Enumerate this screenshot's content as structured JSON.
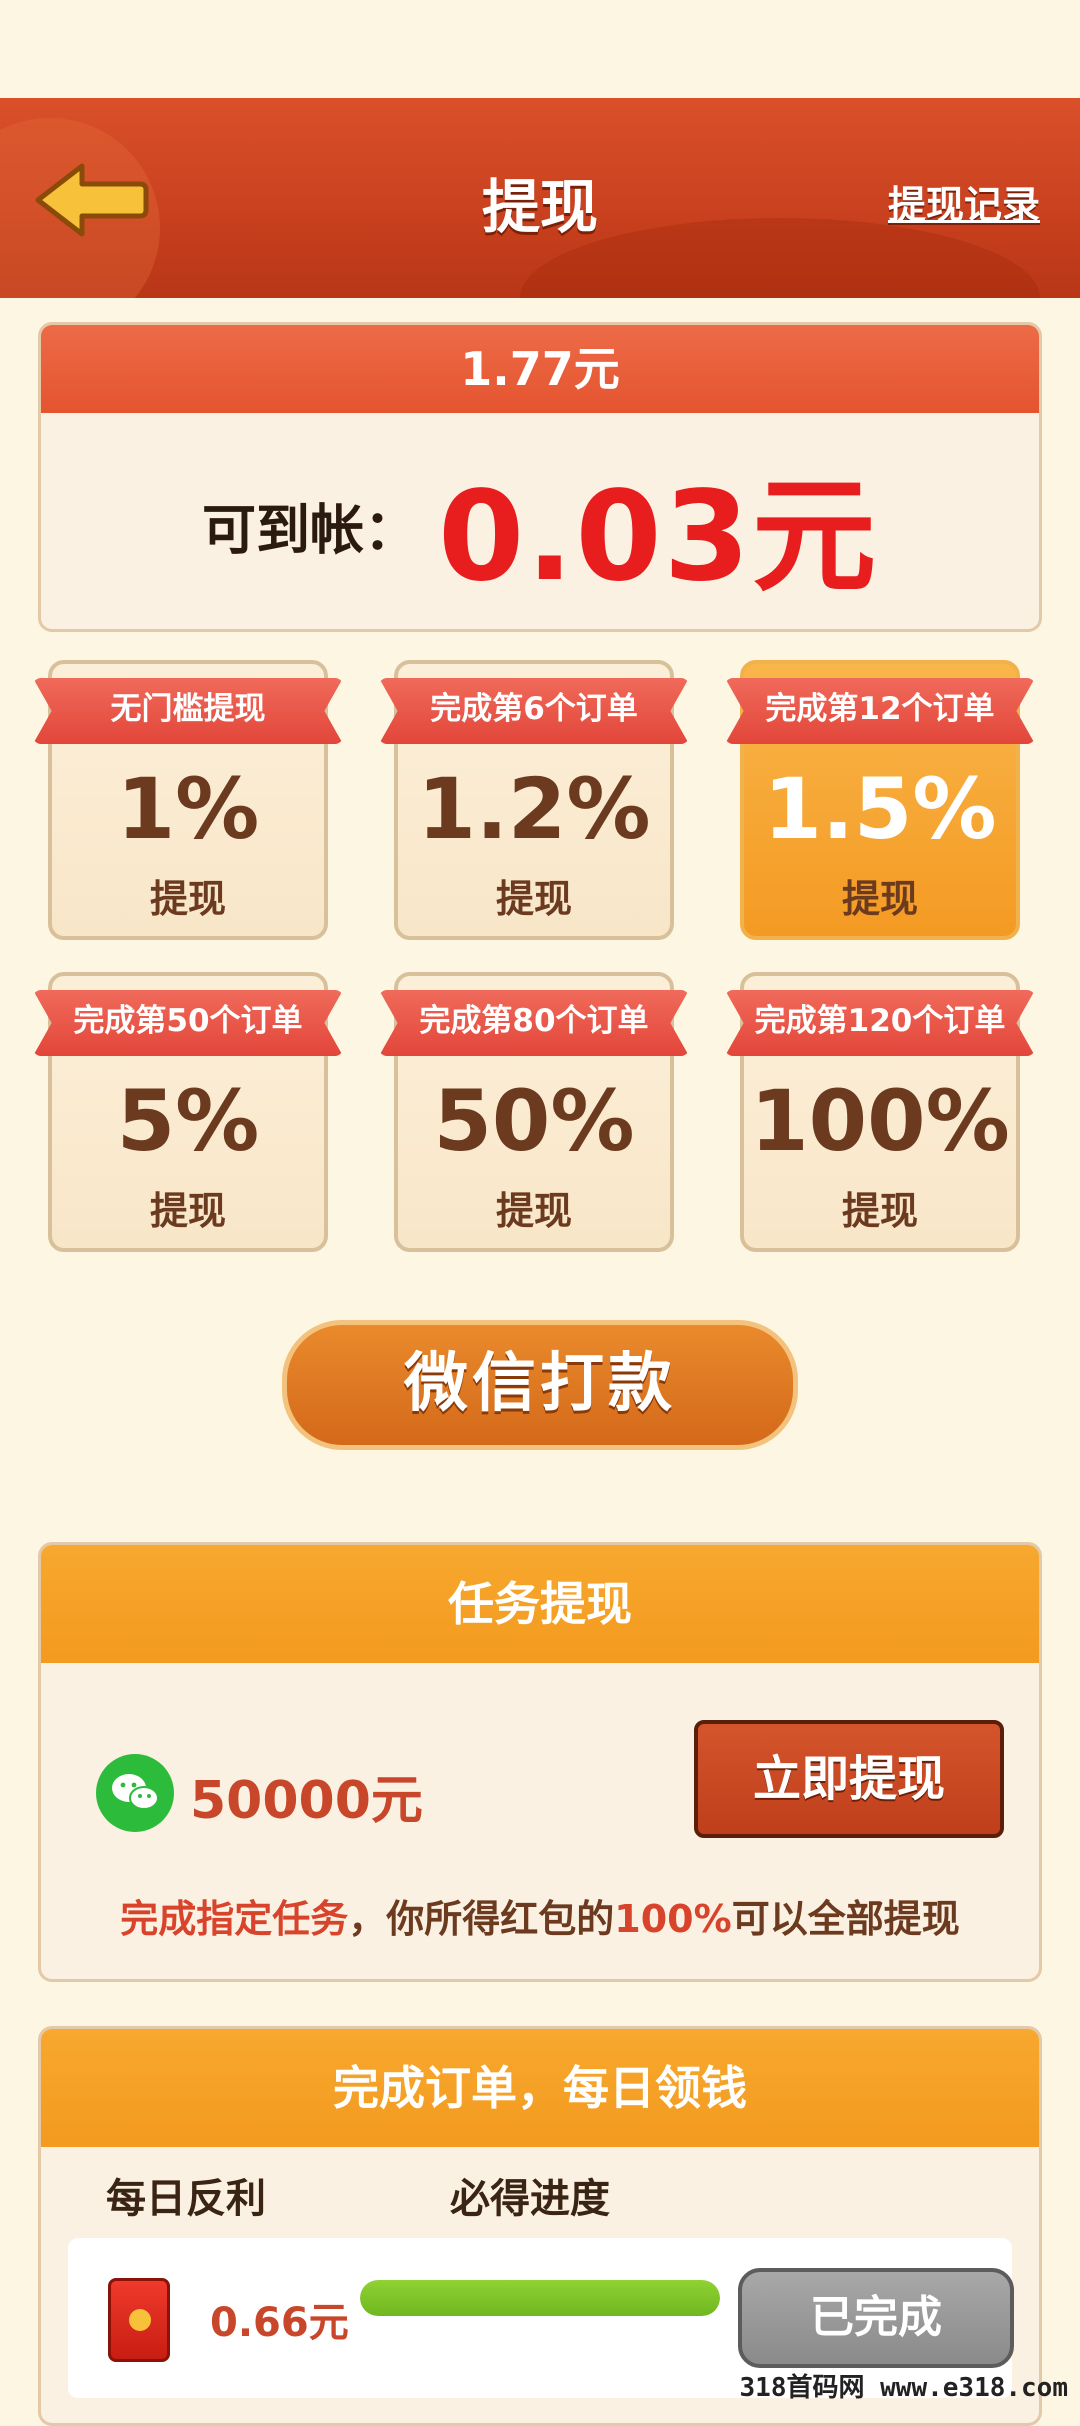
{
  "header": {
    "title": "提现",
    "record_link": "提现记录"
  },
  "balance": {
    "total": "1.77元",
    "arrive_label": "可到帐：",
    "arrive_value": "0.03元"
  },
  "tiers": [
    {
      "ribbon": "无门槛提现",
      "rate": "1%",
      "sub": "提现",
      "active": false
    },
    {
      "ribbon": "完成第6个订单",
      "rate": "1.2%",
      "sub": "提现",
      "active": false
    },
    {
      "ribbon": "完成第12个订单",
      "rate": "1.5%",
      "sub": "提现",
      "active": true
    },
    {
      "ribbon": "完成第50个订单",
      "rate": "5%",
      "sub": "提现",
      "active": false
    },
    {
      "ribbon": "完成第80个订单",
      "rate": "50%",
      "sub": "提现",
      "active": false
    },
    {
      "ribbon": "完成第120个订单",
      "rate": "100%",
      "sub": "提现",
      "active": false
    }
  ],
  "pay_button": "微信打款",
  "task": {
    "title": "任务提现",
    "amount": "50000元",
    "button": "立即提现",
    "desc_part1": "完成指定任务",
    "desc_part2": "，你所得红包的",
    "desc_part3": "100%",
    "desc_part4": "可以全部提现"
  },
  "daily": {
    "title": "完成订单，每日领钱",
    "col1": "每日反利",
    "col2": "必得进度",
    "row_amount": "0.66元",
    "progress": 1.0,
    "row_button": "已完成"
  },
  "watermark": "318首码网 www.e318.com",
  "colors": {
    "header_red": "#d9502a",
    "accent_red": "#e81d1d",
    "orange": "#f39a1f",
    "wechat_green": "#2dbb3c"
  }
}
